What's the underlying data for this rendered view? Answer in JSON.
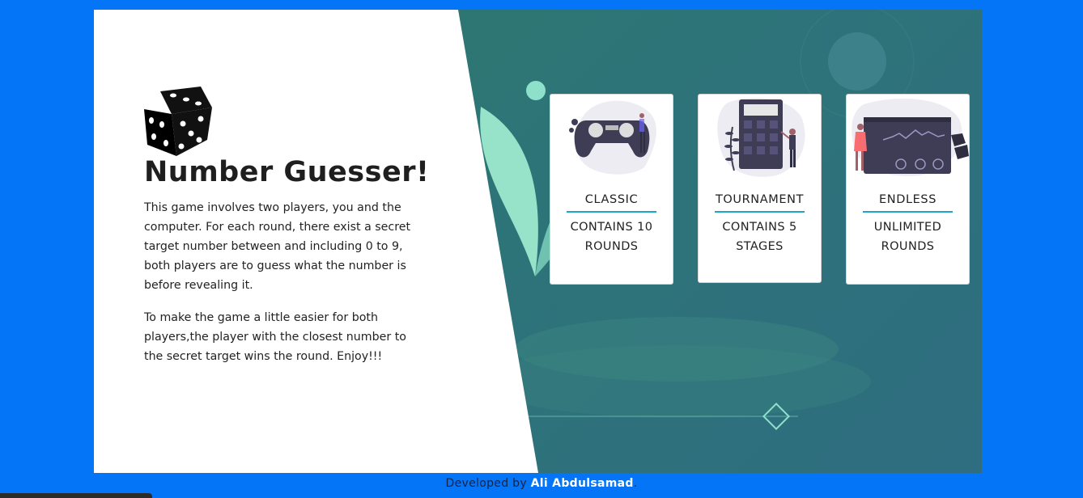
{
  "intro": {
    "title": "Number Guesser!",
    "paragraph1": "This game involves two players, you and the computer. For each round, there exist a secret target number between and including 0 to 9, both players are to guess what the number is before revealing it.",
    "paragraph2": "To make the game a little easier for both players,the player with the closest number to the secret target wins the round. Enjoy!!!"
  },
  "cards": [
    {
      "mode": "CLASSIC",
      "description": "CONTAINS 10 ROUNDS",
      "icon": "gamepad-illustration-icon"
    },
    {
      "mode": "TOURNAMENT",
      "description": "CONTAINS 5 STAGES",
      "icon": "calculator-illustration-icon"
    },
    {
      "mode": "ENDLESS",
      "description": "UNLIMITED ROUNDS",
      "icon": "dashboard-illustration-icon"
    }
  ],
  "footer": {
    "prefix": "Developed by",
    "author": "Ali Abdulsamad",
    "suffix": "."
  },
  "colors": {
    "page_background": "#0575f7",
    "accent_rule": "#1fa5c8",
    "panel_teal": "#2f7a6a"
  }
}
